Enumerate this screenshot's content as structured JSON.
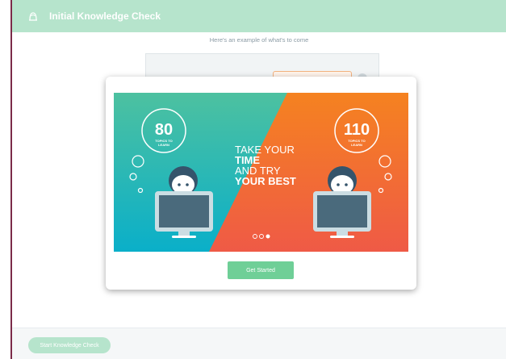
{
  "header": {
    "title": "Initial Knowledge Check",
    "icon": "bust-outline-icon"
  },
  "subtitle": "Here's an example of what's to come",
  "modal": {
    "slide": {
      "left_badge": {
        "number": "80",
        "caption_line1": "TOPICS TO",
        "caption_line2": "LEARN"
      },
      "right_badge": {
        "number": "110",
        "caption_line1": "TOPICS TO",
        "caption_line2": "LEARN"
      },
      "headline": [
        "TAKE YOUR",
        "TIME",
        "AND TRY",
        "YOUR BEST"
      ],
      "pager": {
        "total": 3,
        "active": 3
      },
      "colors": {
        "teal_top": "#4dc1a0",
        "teal_bottom": "#0aafc9",
        "orange_top": "#f58220",
        "orange_bottom": "#ef5a46"
      }
    },
    "button_label": "Get Started"
  },
  "footer": {
    "button_label": "Start Knowledge Check"
  },
  "colors": {
    "header_bg": "#b6e4cc",
    "primary_button": "#6fcf97",
    "accent_border": "#7b2b49"
  }
}
